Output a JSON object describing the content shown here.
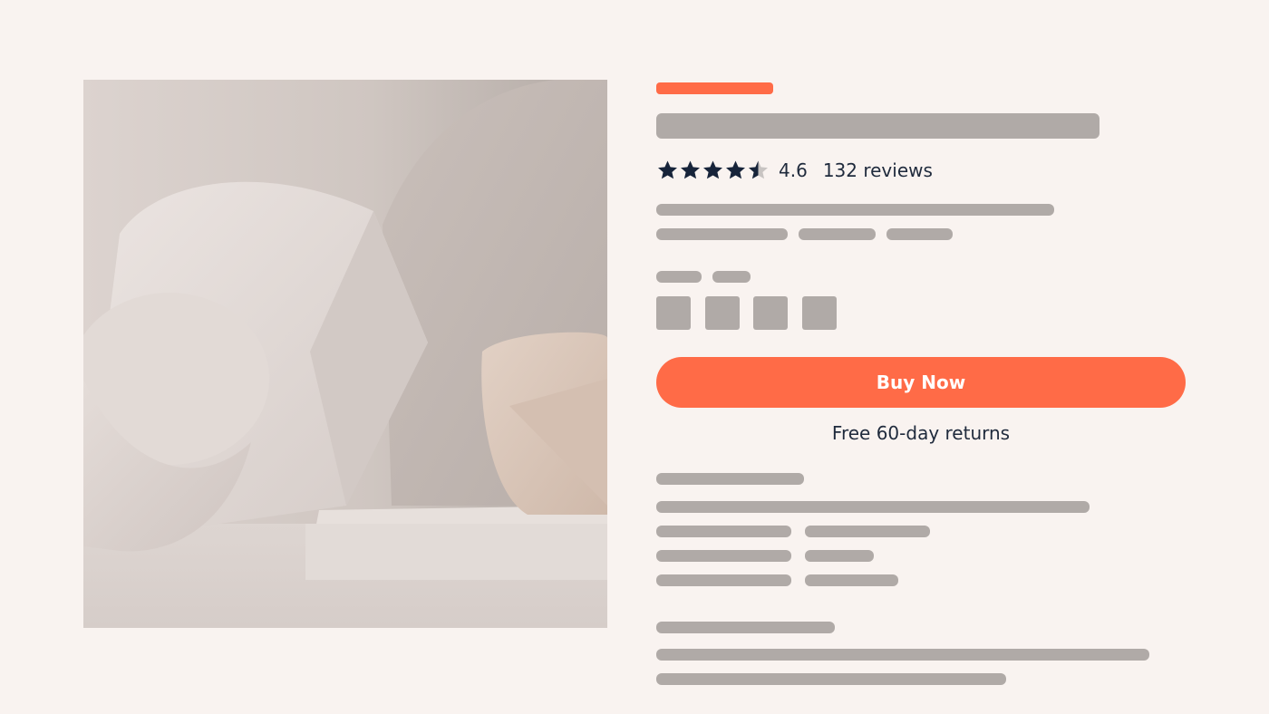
{
  "colors": {
    "background": "#f9f3f0",
    "accent": "#ff6b47",
    "placeholder": "#b0aaa7",
    "text": "#1f2a3c",
    "star": "#17243a",
    "star_empty": "#c8c4c2"
  },
  "product": {
    "image_icon": "product-photo",
    "rating": {
      "stars_filled": 4.5,
      "stars_total": 5,
      "value": "4.6",
      "reviews": "132 reviews"
    },
    "buy_button_label": "Buy Now",
    "returns_text": "Free 60-day returns"
  }
}
